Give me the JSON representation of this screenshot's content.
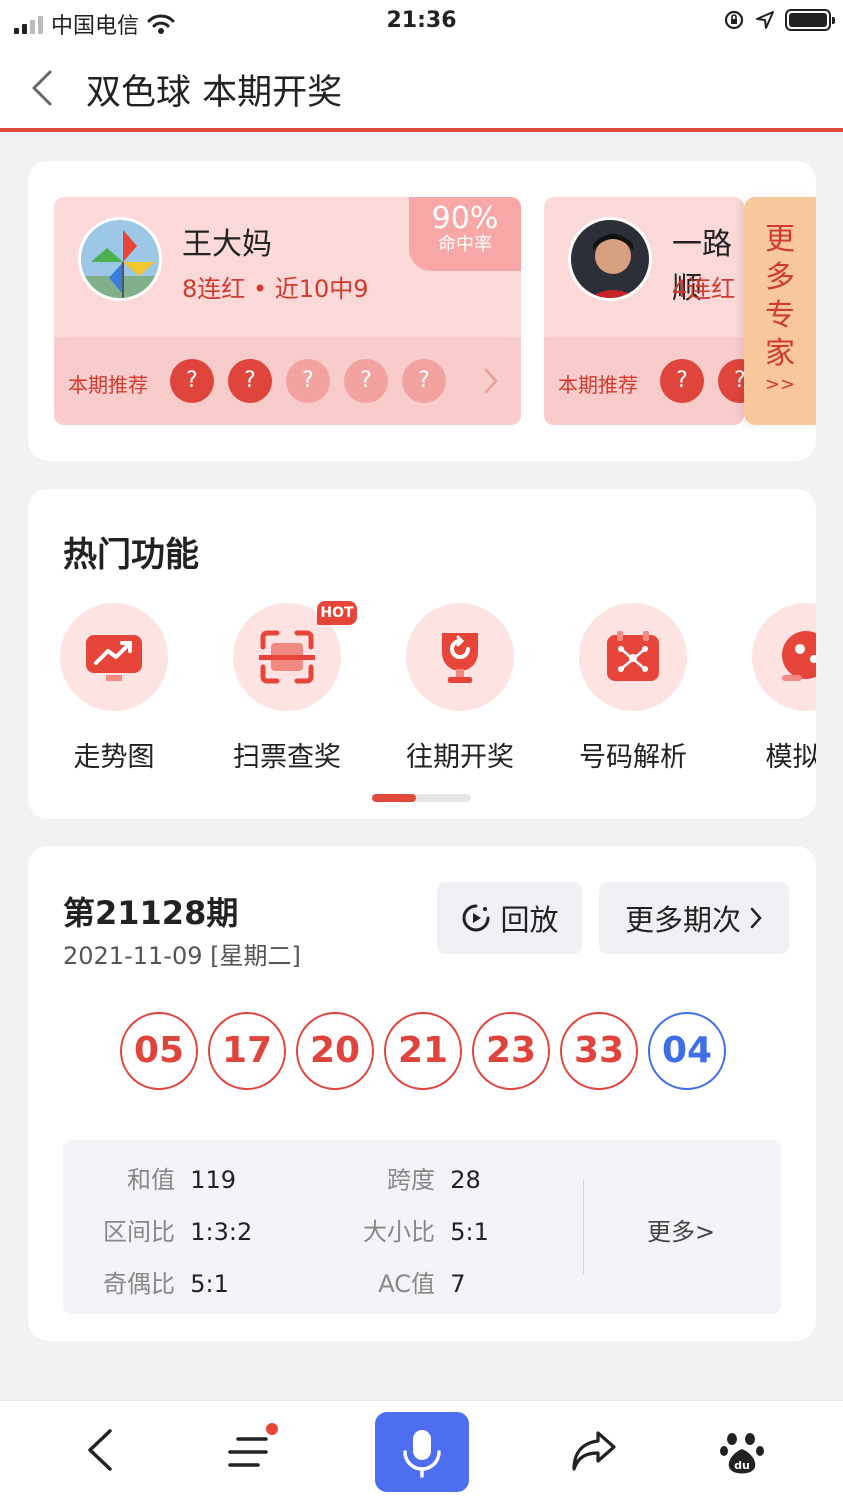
{
  "status_bar": {
    "carrier": "中国电信",
    "time": "21:36"
  },
  "nav": {
    "title": "双色球 本期开奖"
  },
  "experts": {
    "items": [
      {
        "name": "王大妈",
        "streak": "8连红",
        "recent": "近10中9",
        "hit_rate": "90%",
        "hit_label": "命中率",
        "rec_label": "本期推荐",
        "balls": [
          "?",
          "?",
          "?",
          "?",
          "?"
        ]
      },
      {
        "name": "一路顺",
        "streak": "4连红",
        "rec_label": "本期推荐",
        "balls": [
          "?",
          "?"
        ]
      }
    ],
    "more": {
      "line1": "更",
      "line2": "多",
      "line3": "专",
      "line4": "家",
      "arrow": ">>"
    }
  },
  "hot": {
    "title": "热门功能",
    "features": [
      {
        "label": "走势图",
        "icon": "trend-chart-icon"
      },
      {
        "label": "扫票查奖",
        "icon": "scan-ticket-icon",
        "badge": "HOT"
      },
      {
        "label": "往期开奖",
        "icon": "trophy-history-icon"
      },
      {
        "label": "号码解析",
        "icon": "number-analysis-icon"
      },
      {
        "label": "模拟选",
        "icon": "simulate-pick-icon"
      }
    ]
  },
  "draw": {
    "issue": "第21128期",
    "date": "2021-11-09 [星期二]",
    "replay_label": "回放",
    "more_issues_label": "更多期次",
    "red_balls": [
      "05",
      "17",
      "20",
      "21",
      "23",
      "33"
    ],
    "blue_ball": "04",
    "stats": {
      "sum_label": "和值",
      "sum": "119",
      "span_label": "跨度",
      "span": "28",
      "zone_label": "区间比",
      "zone": "1:3:2",
      "size_label": "大小比",
      "size": "5:1",
      "odd_label": "奇偶比",
      "odd": "5:1",
      "ac_label": "AC值",
      "ac": "7",
      "more": "更多>"
    }
  },
  "colors": {
    "accent_red": "#e14b3c",
    "blue_ball": "#3f6fe8",
    "mic_blue": "#4e6ef2"
  }
}
